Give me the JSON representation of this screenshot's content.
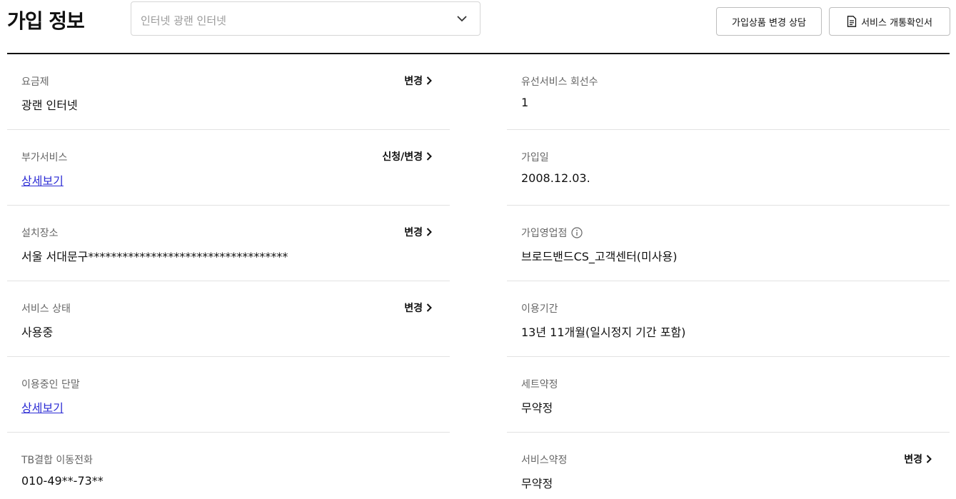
{
  "header": {
    "title": "가입 정보",
    "product_select": {
      "value": "인터넷 광랜 인터넷",
      "icon": "chevron-down-icon"
    },
    "consult_button": "가입상품 변경 상담",
    "certificate_button": "서비스 개통확인서"
  },
  "left": {
    "plan": {
      "label": "요금제",
      "value": "광랜 인터넷",
      "action": "변경"
    },
    "addon": {
      "label": "부가서비스",
      "link": "상세보기",
      "action": "신청/변경"
    },
    "location": {
      "label": "설치장소",
      "value": "서울 서대문구***********************************",
      "action": "변경"
    },
    "status": {
      "label": "서비스 상태",
      "value": "사용중",
      "action": "변경"
    },
    "device": {
      "label": "이용중인 단말",
      "link": "상세보기"
    },
    "mobile": {
      "label": "TB결합 이동전화",
      "value": "010-49**-73**"
    }
  },
  "right": {
    "lines": {
      "label": "유선서비스 회선수",
      "value": "1"
    },
    "join_date": {
      "label": "가입일",
      "value": "2008.12.03."
    },
    "shop": {
      "label": "가입영업점",
      "value": "브로드밴드CS_고객센터(미사용)",
      "icon": "info-icon"
    },
    "period": {
      "label": "이용기간",
      "value": "13년 11개월(일시정지 기간 포함)"
    },
    "set_contract": {
      "label": "세트약정",
      "value": "무약정"
    },
    "service_contract": {
      "label": "서비스약정",
      "value": "무약정",
      "action": "변경"
    }
  },
  "colors": {
    "link": "#2b2bd4",
    "label": "#666666",
    "divider": "#111111"
  }
}
